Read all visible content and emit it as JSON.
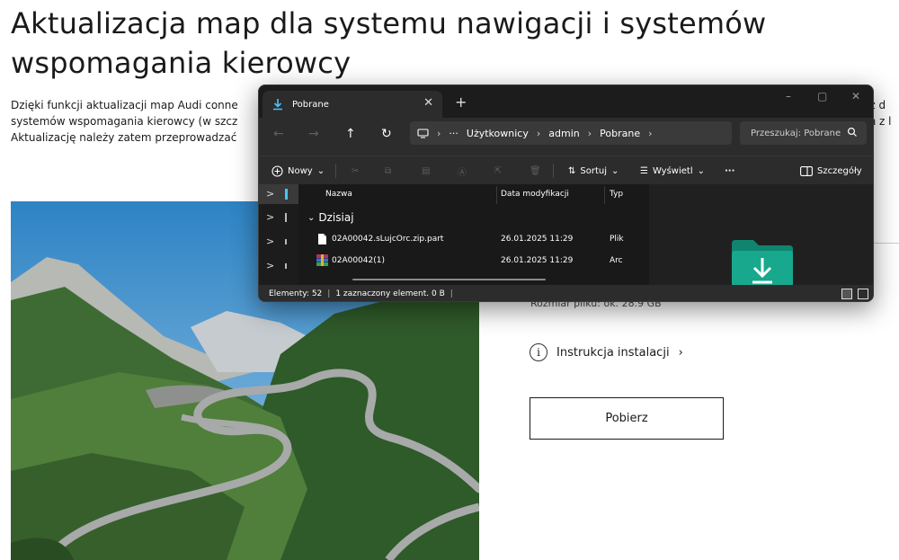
{
  "page": {
    "title": "Aktualizacja map dla systemu nawigacji i systemów wspomagania kierowcy",
    "intro_lines": [
      "Dzięki funkcji aktualizacji map Audi conne",
      "systemów wspomagania kierowcy (w szcz",
      "Aktualizację należy zatem przeprowadzać"
    ],
    "intro_right_lines": [
      "eż d",
      "ch z l"
    ],
    "file_size": "Rozmiar pliku: ok. 28.9 GB",
    "install_link": "Instrukcja instalacji",
    "install_chevron": "›",
    "info_icon": "info-circle-icon",
    "download_label": "Pobierz"
  },
  "explorer": {
    "tab_title": "Pobrane",
    "tab_close": "✕",
    "tab_new": "+",
    "window_controls": {
      "minimize": "–",
      "maximize": "▢",
      "close": "✕"
    },
    "nav": {
      "back": "←",
      "forward": "→",
      "up": "↑",
      "refresh": "↻"
    },
    "address": {
      "more": "···",
      "path": [
        "Użytkownicy",
        "admin",
        "Pobrane"
      ],
      "sep": "›"
    },
    "search_placeholder": "Przeszukaj: Pobrane",
    "toolbar": {
      "new_label": "Nowy",
      "sort_label": "Sortuj",
      "view_label": "Wyświetl",
      "more": "···",
      "details_label": "Szczegóły",
      "dropdown": "⌄"
    },
    "columns": {
      "name": "Nazwa",
      "modified": "Data modyfikacji",
      "type": "Typ"
    },
    "group": "Dzisiaj",
    "group_chevron": "⌄",
    "nav_glyphs": [
      ">",
      ">",
      ">",
      ">"
    ],
    "files": [
      {
        "name": "02A00042.sLujcOrc.zip.part",
        "modified": "26.01.2025 11:29",
        "type": "Plik"
      },
      {
        "name": "02A00042(1)",
        "modified": "26.01.2025 11:29",
        "type": "Arc"
      }
    ],
    "status": {
      "count": "Elementy: 52",
      "selection": "1 zaznaczony element. 0 B"
    },
    "colors": {
      "accent": "#4cc2ff",
      "folder": "#18a88e",
      "folder_dark": "#0f8570"
    }
  }
}
